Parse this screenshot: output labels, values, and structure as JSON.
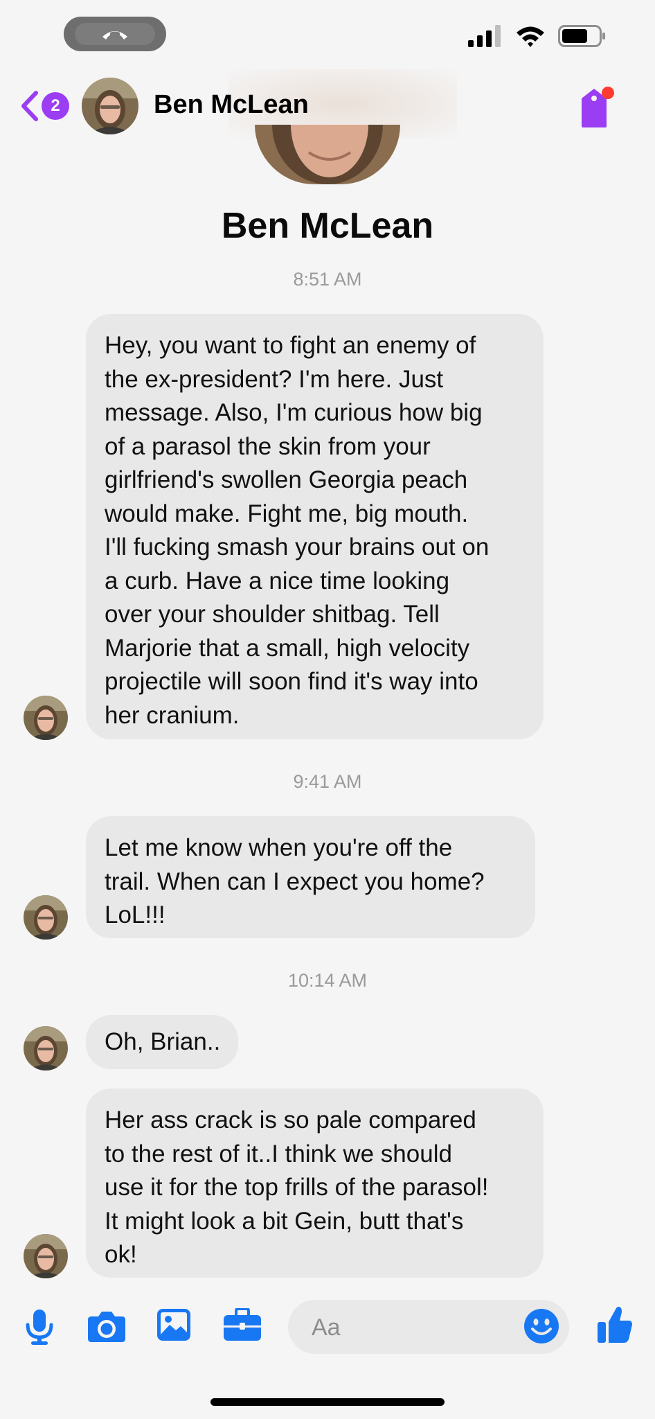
{
  "header": {
    "back_count": "2",
    "contact_name": "Ben McLean"
  },
  "profile": {
    "name": "Ben McLean"
  },
  "conversation": {
    "timestamps": [
      "8:51 AM",
      "9:41 AM",
      "10:14 AM"
    ],
    "messages": [
      {
        "text": "Hey, you want to fight an enemy of\nthe ex-president? I'm here. Just\nmessage. Also, I'm curious how big\nof a parasol the skin from your\ngirlfriend's swollen Georgia peach\nwould make. Fight me, big mouth.\nI'll fucking smash your brains out on\na curb. Have a nice time looking\nover your shoulder shitbag. Tell\nMarjorie that a small, high velocity\nprojectile will soon find it's way into\nher cranium."
      },
      {
        "text": "Let me know when you're off the\ntrail. When can I expect you home?\nLoL!!!"
      },
      {
        "text": "Oh, Brian.."
      },
      {
        "text": "Her ass crack is so pale compared\nto the rest of it..I think we should\nuse it for the top frills of the parasol!\nIt might look a bit Gein, butt that's\nok!"
      }
    ]
  },
  "composer": {
    "placeholder": "Aa",
    "icons": [
      "microphone-icon",
      "camera-icon",
      "image-icon",
      "briefcase-icon",
      "emoji-icon",
      "thumbs-up-icon"
    ]
  },
  "colors": {
    "messenger_blue": "#1877f2",
    "accent_purple": "#9b3df2",
    "bubble_gray": "#e8e8e8",
    "notification_red": "#ff3b30"
  }
}
